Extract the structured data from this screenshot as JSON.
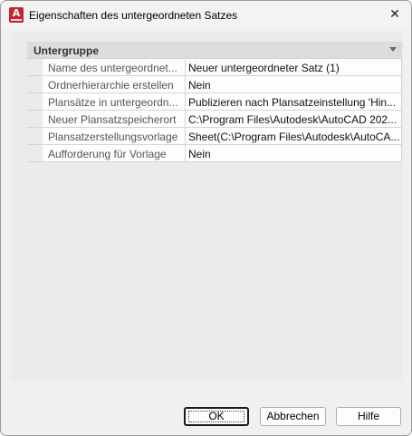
{
  "window": {
    "title": "Eigenschaften des untergeordneten Satzes",
    "icon": "autocad-app-icon",
    "close_symbol": "✕"
  },
  "property_grid": {
    "group_title": "Untergruppe",
    "rows": [
      {
        "name": "Name des untergeordnet...",
        "value": "Neuer untergeordneter Satz (1)"
      },
      {
        "name": "Ordnerhierarchie erstellen",
        "value": "Nein"
      },
      {
        "name": "Plansätze in untergeordn...",
        "value": "Publizieren nach Plansatzeinstellung 'Hin..."
      },
      {
        "name": "Neuer Plansatzspeicherort",
        "value": "C:\\Program Files\\Autodesk\\AutoCAD 202..."
      },
      {
        "name": "Plansatzerstellungsvorlage",
        "value": "Sheet(C:\\Program Files\\Autodesk\\AutoCA..."
      },
      {
        "name": "Aufforderung für Vorlage",
        "value": "Nein"
      }
    ]
  },
  "buttons": {
    "ok": "OK",
    "cancel": "Abbrechen",
    "help": "Hilfe"
  },
  "colors": {
    "app_icon": "#c4262e",
    "dialog_bg": "#f0f0f0",
    "group_header_bg": "#dcdcdc"
  }
}
